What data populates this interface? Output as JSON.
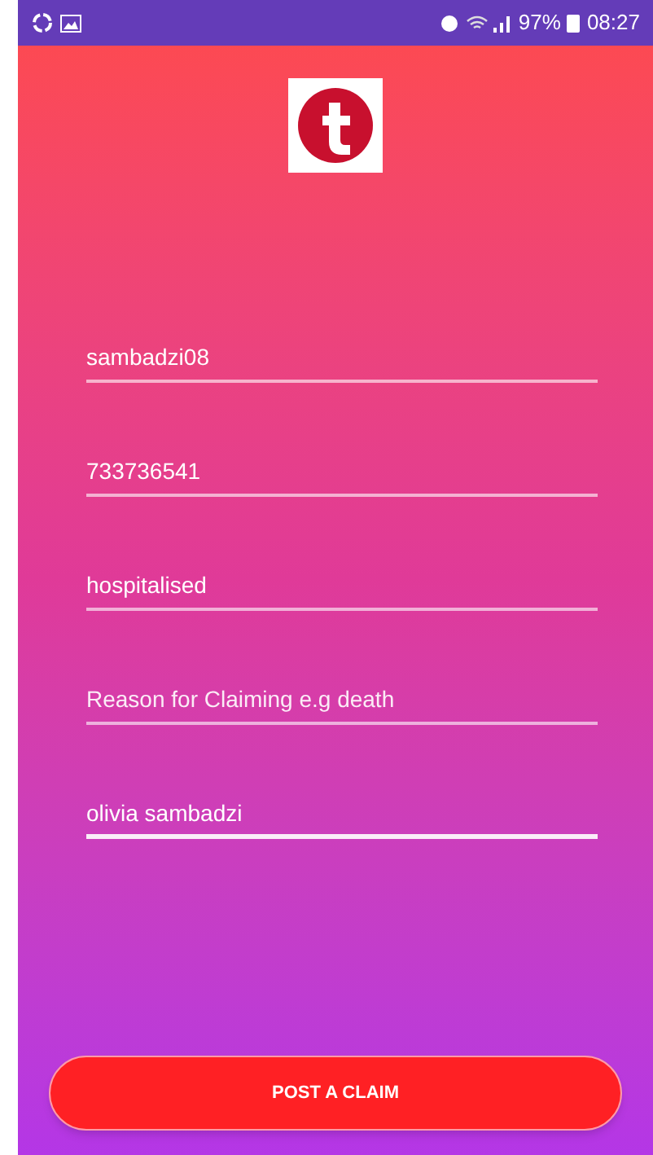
{
  "status_bar": {
    "battery": "97%",
    "time": "08:27"
  },
  "fields": [
    {
      "value": "sambadzi08",
      "focused": false
    },
    {
      "value": "733736541",
      "focused": false
    },
    {
      "value": "hospitalised",
      "focused": false
    },
    {
      "placeholder": "Reason for Claiming e.g death",
      "focused": false
    },
    {
      "value": "olivia sambadzi",
      "focused": true
    }
  ],
  "submit_button": "POST A CLAIM"
}
